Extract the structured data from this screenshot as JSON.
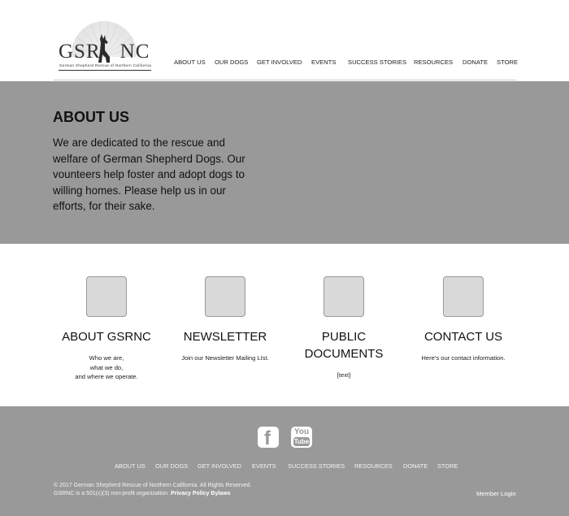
{
  "header": {
    "logo": {
      "text": "GSRNC",
      "subtitle": "German Shepherd Rescue of Northern California"
    },
    "nav": [
      "ABOUT US",
      "OUR DOGS",
      "GET INVOLVED",
      "EVENTS",
      "SUCCESS STORIES",
      "RESOURCES",
      "DONATE",
      "STORE"
    ]
  },
  "hero": {
    "title": "ABOUT US",
    "text": "We are dedicated to the rescue and welfare of German Shepherd Dogs. Our vounteers help foster and adopt dogs to willing homes. Please help us in our efforts, for their sake."
  },
  "features": [
    {
      "title": "ABOUT GSRNC",
      "desc": [
        "Who we are,",
        "what we do,",
        "and where we operate."
      ]
    },
    {
      "title": "NEWSLETTER",
      "desc": [
        "Join our Newsletter Mailing LIst."
      ]
    },
    {
      "title": "PUBLIC DOCUMENTS",
      "desc": [
        "[text]"
      ]
    },
    {
      "title": "CONTACT US",
      "desc": [
        "Here's our contact information."
      ]
    }
  ],
  "footer": {
    "social": {
      "facebook": "facebook-icon",
      "youtube": "youtube-icon",
      "youtube_top": "You",
      "youtube_bottom": "Tube"
    },
    "nav": [
      "ABOUT US",
      "OUR DOGS",
      "GET INVOLVED",
      "EVENTS",
      "SUCCESS STORIES",
      "RESOURCES",
      "DONATE",
      "STORE"
    ],
    "copyright_line1": "©  2017 German Shepherd Rescue of Northern California. All Rights Reserved.",
    "copyright_line2": "GSRNC is a 501(c)(3) non-profit organization.",
    "privacy_link": "Privacy Policy",
    "bylaws_link": "Bylaws",
    "member_login": "Member Login"
  },
  "colors": {
    "band": "#999999",
    "icon_fill": "#d9d9d9"
  }
}
